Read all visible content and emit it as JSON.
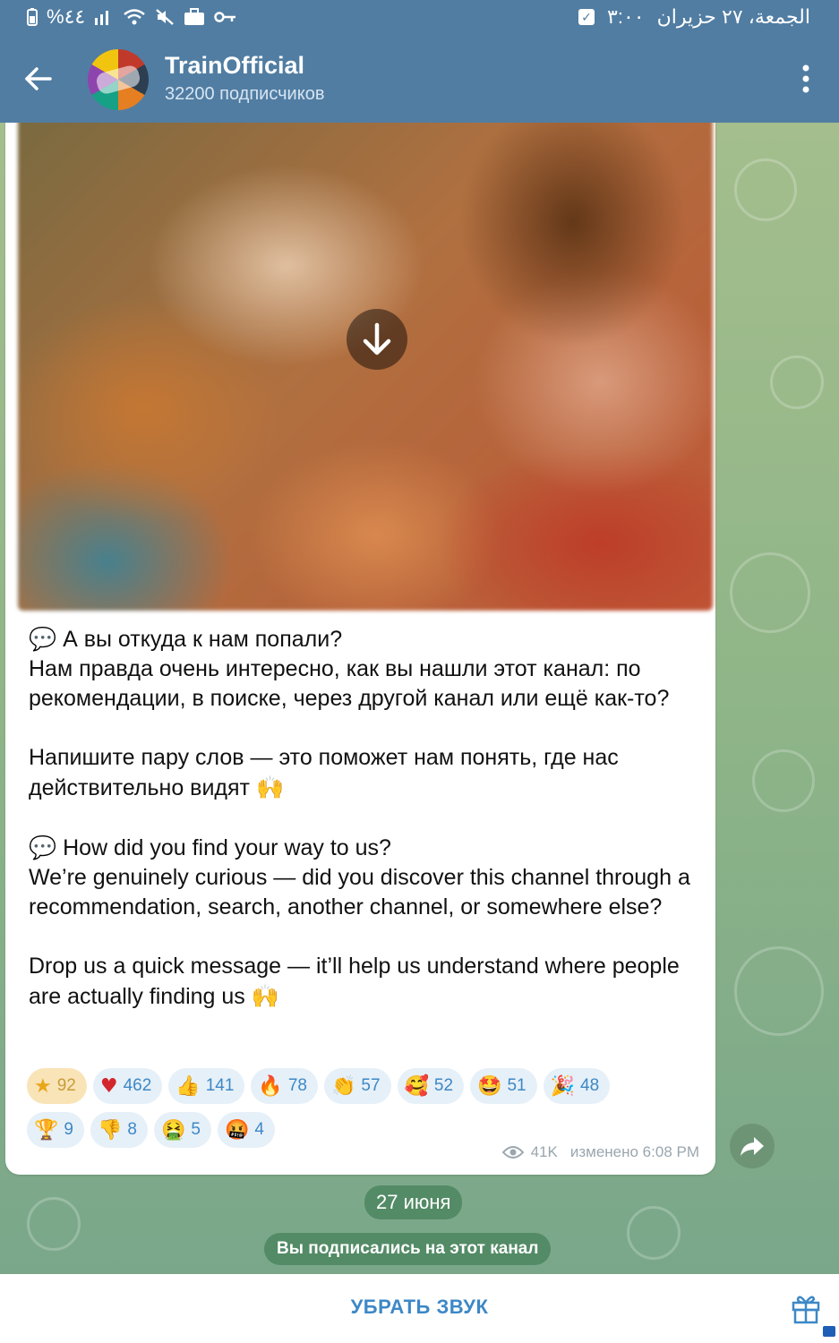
{
  "status_bar": {
    "left_text": "%٤٤",
    "time": "٣:٠٠",
    "date": "الجمعة، ٢٧ حزيران"
  },
  "header": {
    "title": "TrainOfficial",
    "subtitle": "32200 подписчиков"
  },
  "message": {
    "ru_emoji": "💬",
    "ru_heading": " А вы откуда к нам попали?",
    "ru_body": "Нам правда очень интересно, как вы нашли этот канал: по рекомендации, в поиске, через другой канал или ещё как-то?",
    "ru_cta": "Напишите пару слов — это поможет нам понять, где нас действительно видят ",
    "ru_cta_emoji": "🙌",
    "en_emoji": "💬",
    "en_heading": " How did you find your way to us?",
    "en_body": "We’re genuinely curious — did you discover this channel through a recommendation, search, another channel, or somewhere else?",
    "en_cta": "Drop us a quick message — it’ll help us understand where people are actually finding us ",
    "en_cta_emoji": "🙌",
    "views": "41K",
    "edited": "изменено 6:08 PM"
  },
  "reactions": [
    {
      "icon": "★",
      "count": "92"
    },
    {
      "icon": "♥",
      "count": "462"
    },
    {
      "icon": "👍",
      "count": "141"
    },
    {
      "icon": "🔥",
      "count": "78"
    },
    {
      "icon": "👏",
      "count": "57"
    },
    {
      "icon": "🥰",
      "count": "52"
    },
    {
      "icon": "🤩",
      "count": "51"
    },
    {
      "icon": "🎉",
      "count": "48"
    },
    {
      "icon": "🏆",
      "count": "9"
    },
    {
      "icon": "👎",
      "count": "8"
    },
    {
      "icon": "🤮",
      "count": "5"
    },
    {
      "icon": "🤬",
      "count": "4"
    }
  ],
  "date_pill": "27 июня",
  "service_message": "Вы подписались на этот канал",
  "bottom": {
    "mute_label": "УБРАТЬ ЗВУК"
  },
  "colors": {
    "header": "#517da2",
    "accent": "#3d88c6",
    "bubble": "#ffffff"
  }
}
